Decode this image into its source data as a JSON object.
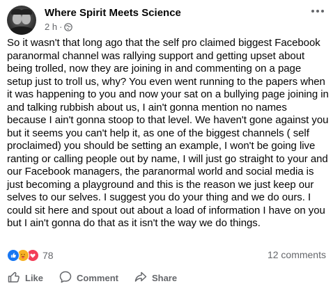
{
  "post": {
    "page_name": "Where Spirit Meets Science",
    "time": "2 h",
    "separator": "·",
    "privacy_icon": "globe-icon",
    "text": "So it wasn't that long ago that the self pro claimed biggest Facebook paranormal channel was rallying support and getting upset about being trolled, now they are joining in and commenting on a page setup just to troll us,  why? You even went running to the papers when it was happening to you and now your sat on a bullying page joining in and talking rubbish about us, I ain't gonna mention no names because I ain't gonna stoop to that level. We haven't gone against you but it seems you can't help it, as one of the biggest channels ( self proclaimed) you should be setting an example, I won't be going live ranting or calling people out by name, I will just go straight to your and our  Facebook managers, the paranormal world and social media is just becoming a playground and this is the reason we just keep our selves to our selves. I suggest you do your thing and we do ours. I could sit here and spout out about a load of information I have on you but I ain't gonna do that as it isn't the way we do things."
  },
  "stats": {
    "reactions": [
      "like",
      "care",
      "love"
    ],
    "reaction_count": "78",
    "comments": "12 comments"
  },
  "actions": {
    "like": "Like",
    "comment": "Comment",
    "share": "Share"
  },
  "colors": {
    "secondary_text": "#65676b",
    "like_blue": "#1877f2",
    "love_red": "#f33e58",
    "care_yellow": "#f7b125"
  }
}
